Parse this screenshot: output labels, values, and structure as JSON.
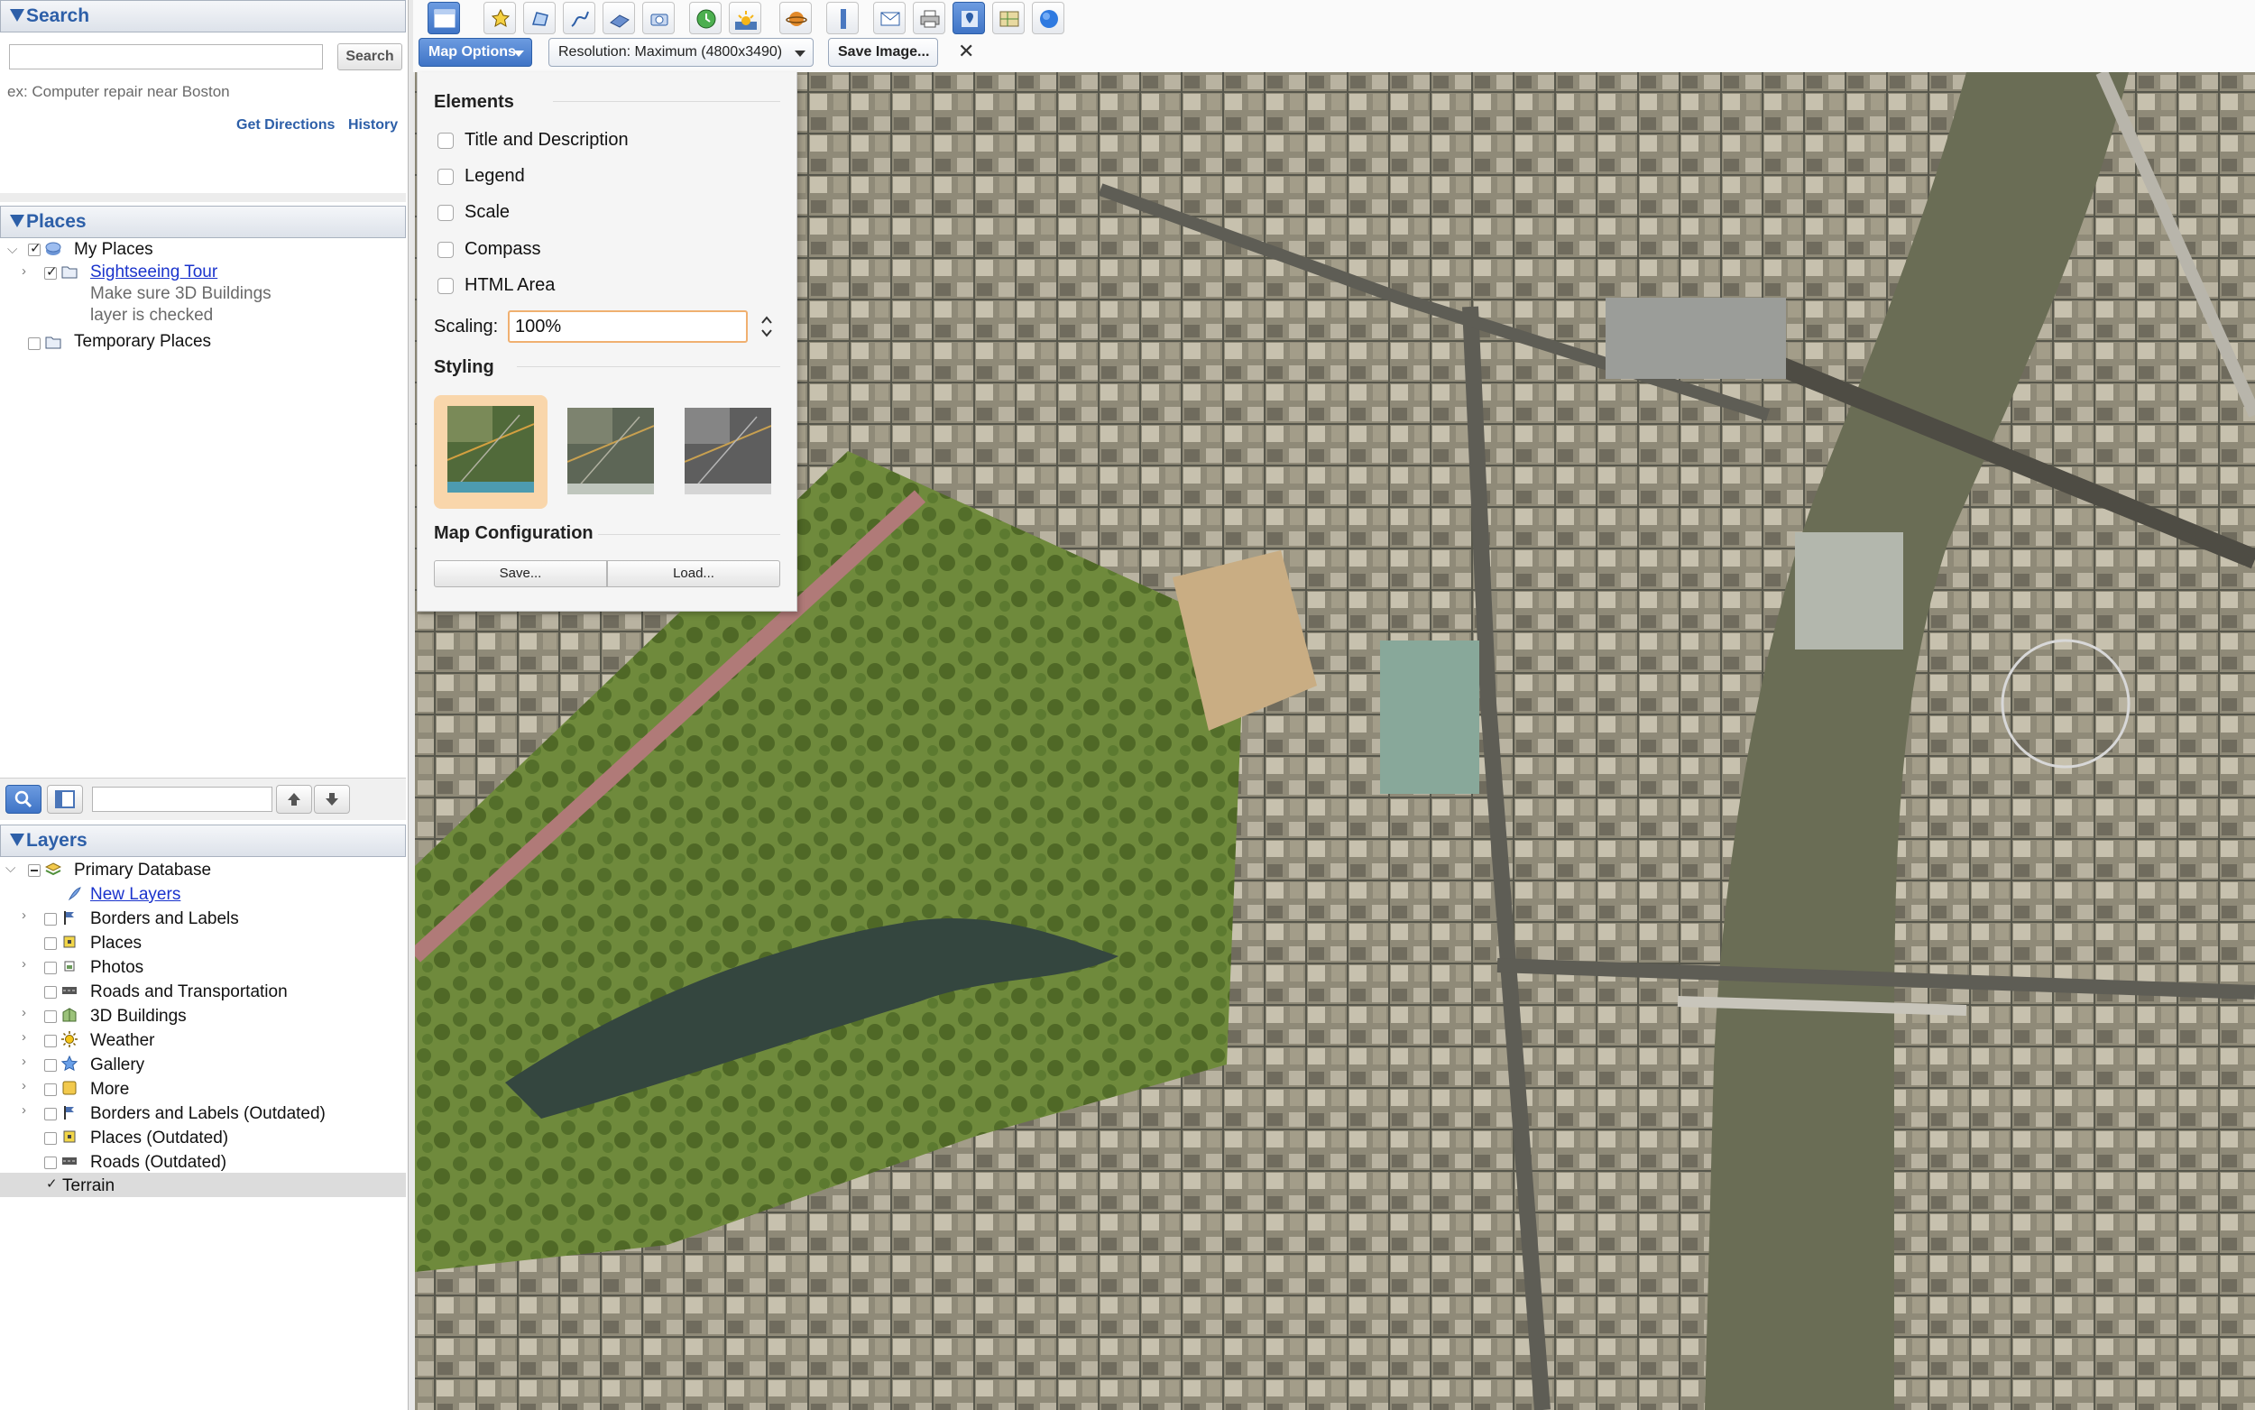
{
  "search": {
    "header": "Search",
    "input_value": "",
    "button": "Search",
    "example": "ex: Computer repair near Boston",
    "get_directions": "Get Directions",
    "history": "History"
  },
  "places": {
    "header": "Places",
    "my_places": "My Places",
    "tour": "Sightseeing Tour",
    "tour_note_1": "Make sure 3D Buildings",
    "tour_note_2": "layer is checked",
    "temporary": "Temporary Places"
  },
  "layers": {
    "header": "Layers",
    "items": [
      "Primary Database",
      "New Layers",
      "Borders and Labels",
      "Places",
      "Photos",
      "Roads and Transportation",
      "3D Buildings",
      "Weather",
      "Gallery",
      "More",
      "Borders and Labels (Outdated)",
      "Places (Outdated)",
      "Roads (Outdated)",
      "Terrain"
    ]
  },
  "toolbar": {
    "map_options": "Map Options",
    "resolution": "Resolution: Maximum (4800x3490)",
    "save_image": "Save Image...",
    "close": "✕"
  },
  "options": {
    "elements_header": "Elements",
    "elements": [
      "Title and Description",
      "Legend",
      "Scale",
      "Compass",
      "HTML Area"
    ],
    "scaling_label": "Scaling:",
    "scaling_value": "100%",
    "styling_header": "Styling",
    "config_header": "Map Configuration",
    "save": "Save...",
    "load": "Load..."
  },
  "colors": {
    "accent": "#2d5fa8",
    "link": "#1a33cc",
    "selection": "#f7c98f"
  }
}
